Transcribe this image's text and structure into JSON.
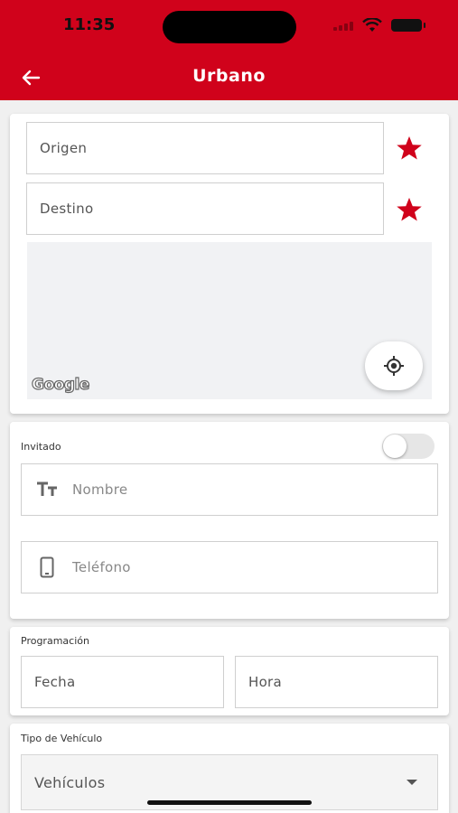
{
  "status_bar": {
    "time": "11:35"
  },
  "header": {
    "title": "Urbano"
  },
  "route": {
    "origin_placeholder": "Origen",
    "destination_placeholder": "Destino",
    "map_logo": "Google",
    "icons": {
      "star": "star-icon",
      "locate": "my-location-icon"
    },
    "accent_color": "#d0021b"
  },
  "guest": {
    "label": "Invitado",
    "toggle_on": false,
    "name_placeholder": "Nombre",
    "phone_placeholder": "Teléfono",
    "icons": {
      "name": "text-format-icon",
      "phone": "phone-icon"
    }
  },
  "schedule": {
    "label": "Programación",
    "date_placeholder": "Fecha",
    "time_placeholder": "Hora"
  },
  "vehicle": {
    "label": "Tipo de Vehículo",
    "selected": "Vehículos"
  }
}
